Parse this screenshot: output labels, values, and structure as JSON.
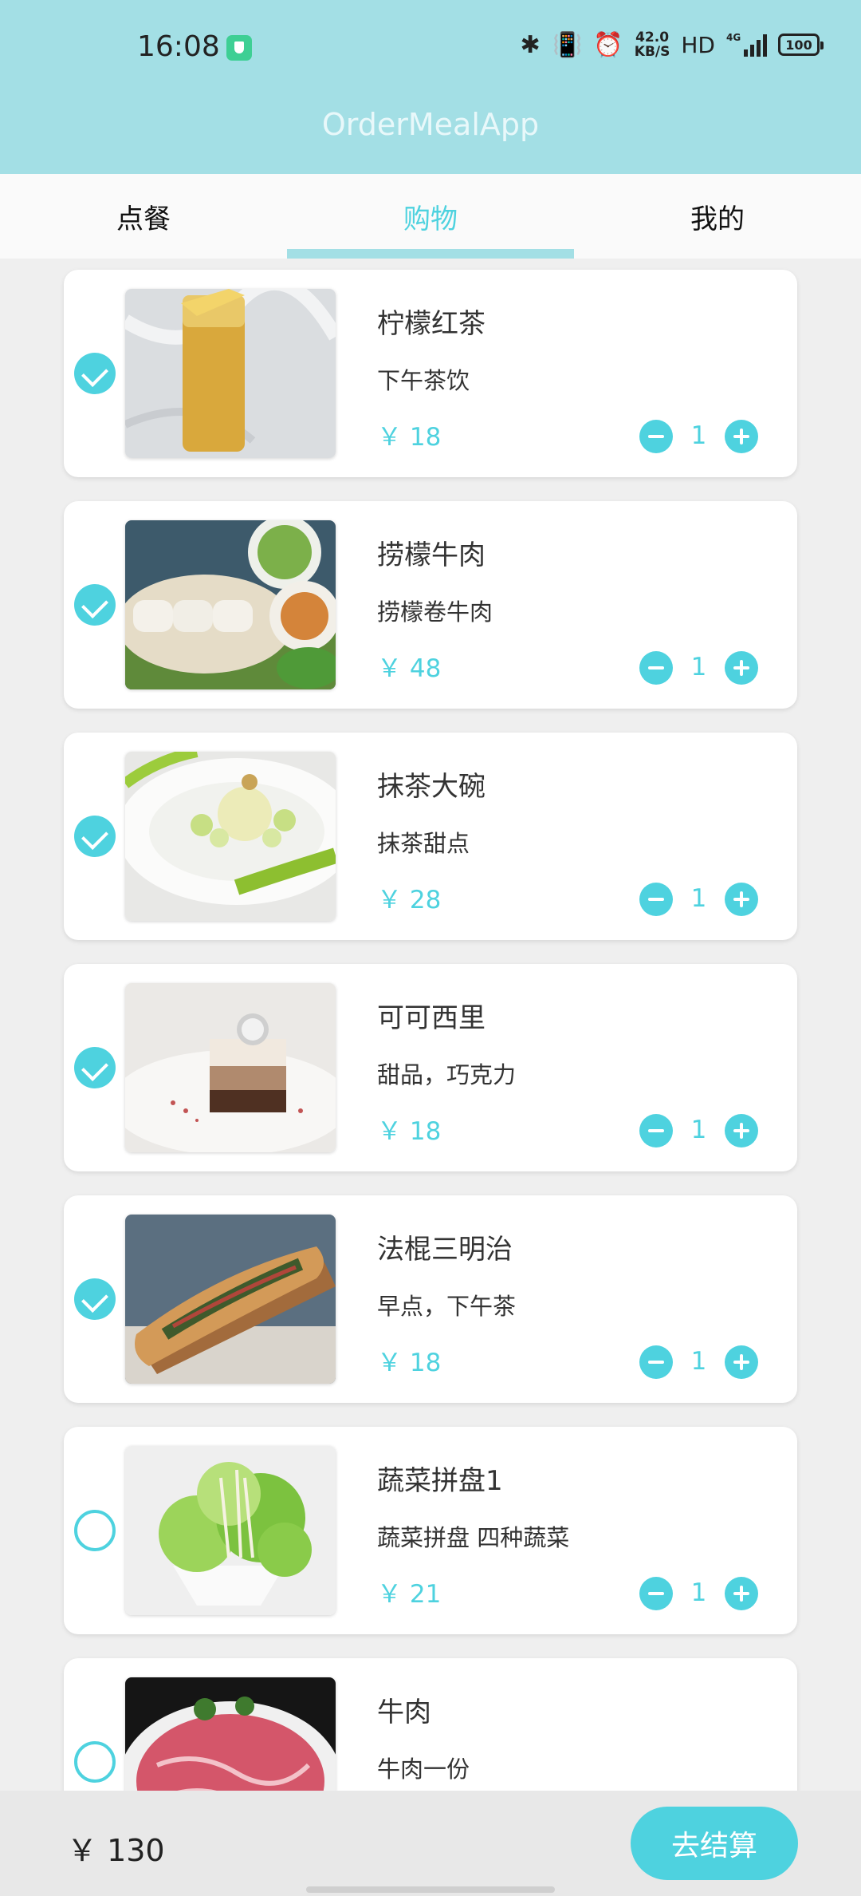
{
  "status_bar": {
    "time": "16:08",
    "net_speed_value": "42.0",
    "net_speed_unit": "KB/S",
    "hd_label": "HD",
    "network_label": "4G",
    "battery": "100",
    "icons": [
      "shield-app-icon",
      "bluetooth-icon",
      "vibrate-icon",
      "alarm-icon",
      "signal-icon",
      "battery-icon"
    ]
  },
  "app_bar": {
    "title": "OrderMealApp"
  },
  "tabs": [
    {
      "label": "点餐",
      "active": false
    },
    {
      "label": "购物",
      "active": true
    },
    {
      "label": "我的",
      "active": false
    }
  ],
  "cart": {
    "items": [
      {
        "name": "柠檬红茶",
        "desc": "下午茶饮",
        "price": "￥ 18",
        "qty": "1",
        "checked": true
      },
      {
        "name": "捞檬牛肉",
        "desc": "捞檬卷牛肉",
        "price": "￥ 48",
        "qty": "1",
        "checked": true
      },
      {
        "name": "抹茶大碗",
        "desc": "抹茶甜点",
        "price": "￥ 28",
        "qty": "1",
        "checked": true
      },
      {
        "name": "可可西里",
        "desc": "甜品，巧克力",
        "price": "￥ 18",
        "qty": "1",
        "checked": true
      },
      {
        "name": "法棍三明治",
        "desc": "早点，下午茶",
        "price": "￥ 18",
        "qty": "1",
        "checked": true
      },
      {
        "name": "蔬菜拼盘1",
        "desc": "蔬菜拼盘 四种蔬菜",
        "price": "￥ 21",
        "qty": "1",
        "checked": false
      },
      {
        "name": "牛肉",
        "desc": "牛肉一份",
        "price": "",
        "qty": "",
        "checked": false
      }
    ]
  },
  "footer": {
    "total": "￥ 130",
    "checkout_label": "去结算"
  },
  "colors": {
    "header": "#a3dfe5",
    "accent": "#4ed2df",
    "background": "#efefef"
  }
}
